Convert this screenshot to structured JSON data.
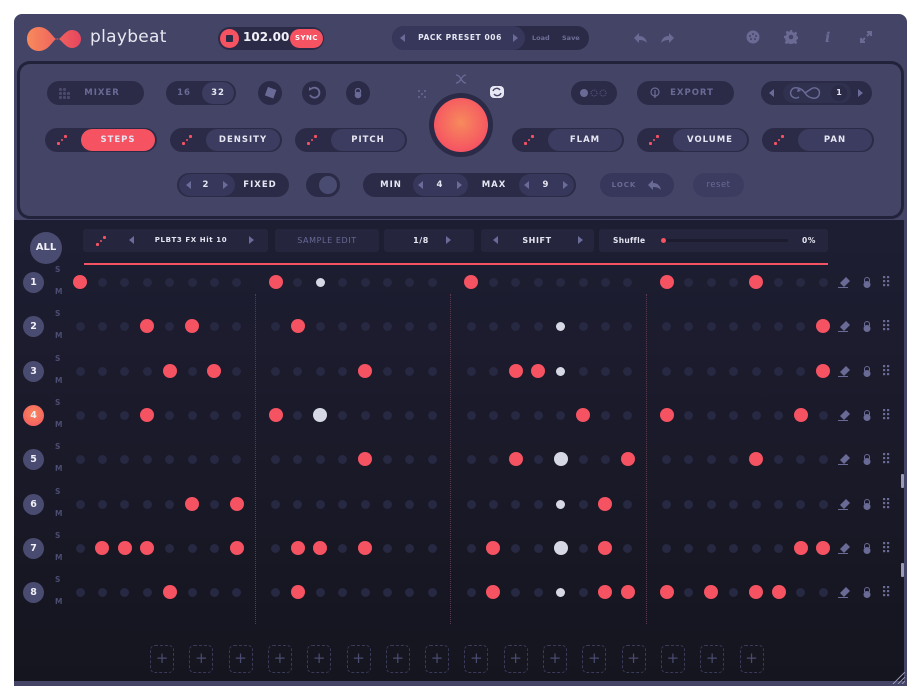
{
  "header": {
    "brand": "playbeat",
    "bpm": "102.00",
    "sync_label": "SYNC",
    "preset_name": "PACK PRESET 006",
    "load_label": "Load",
    "save_label": "Save",
    "icons": [
      "undo-icon",
      "redo-icon",
      "midi-icon",
      "settings-icon",
      "info-icon",
      "expand-icon"
    ]
  },
  "panel": {
    "mixer_label": "MIXER",
    "steps_16": "16",
    "steps_32": "32",
    "export_label": "EXPORT",
    "loop_count": "1",
    "steps_label": "STEPS",
    "density_label": "DENSITY",
    "pitch_label": "PITCH",
    "flam_label": "FLAM",
    "volume_label": "VOLUME",
    "pan_label": "PAN",
    "fixed_value": "2",
    "fixed_label": "FIXED",
    "min_label": "MIN",
    "min_value": "4",
    "max_label": "MAX",
    "max_value": "9",
    "lock_label": "LOCK",
    "reset_label": "reset"
  },
  "track_strip": {
    "all_label": "ALL",
    "sample_name": "PLBT3 FX Hit 10",
    "sample_edit_label": "SAMPLE EDIT",
    "division": "1/8",
    "shift_label": "SHIFT",
    "shuffle_label": "Shuffle",
    "shuffle_value": "0%",
    "shuffle_fraction": 0
  },
  "sequencer": {
    "steps_per_row": 32,
    "selected_row": 4,
    "solo_label": "S",
    "mute_label": "M",
    "rows": [
      {
        "num": "1",
        "on": [
          0,
          8,
          16,
          24,
          28
        ],
        "accent_small": [
          10
        ],
        "accent_big": []
      },
      {
        "num": "2",
        "on": [
          3,
          5,
          9,
          31
        ],
        "accent_small": [
          20
        ],
        "accent_big": []
      },
      {
        "num": "3",
        "on": [
          4,
          6,
          12,
          18,
          19,
          31
        ],
        "accent_small": [
          20
        ],
        "accent_big": []
      },
      {
        "num": "4",
        "on": [
          3,
          8,
          21,
          24,
          30
        ],
        "accent_small": [],
        "accent_big": [
          10
        ]
      },
      {
        "num": "5",
        "on": [
          12,
          18,
          23,
          28
        ],
        "accent_small": [],
        "accent_big": [
          20
        ]
      },
      {
        "num": "6",
        "on": [
          5,
          7,
          22
        ],
        "accent_small": [
          20
        ],
        "accent_big": []
      },
      {
        "num": "7",
        "on": [
          1,
          2,
          3,
          7,
          9,
          10,
          12,
          17,
          22,
          30,
          31
        ],
        "accent_small": [],
        "accent_big": [
          20
        ]
      },
      {
        "num": "8",
        "on": [
          4,
          9,
          17,
          22,
          23,
          24,
          26,
          28,
          29
        ],
        "accent_small": [
          20
        ],
        "accent_big": []
      }
    ],
    "add_slots": 16,
    "add_label": "+"
  },
  "colors": {
    "accent": "#f55262",
    "panel": "#434466",
    "dark": "#2b2b47",
    "grid": "#1a1a2c",
    "accent_white": "#d6d8e6"
  }
}
